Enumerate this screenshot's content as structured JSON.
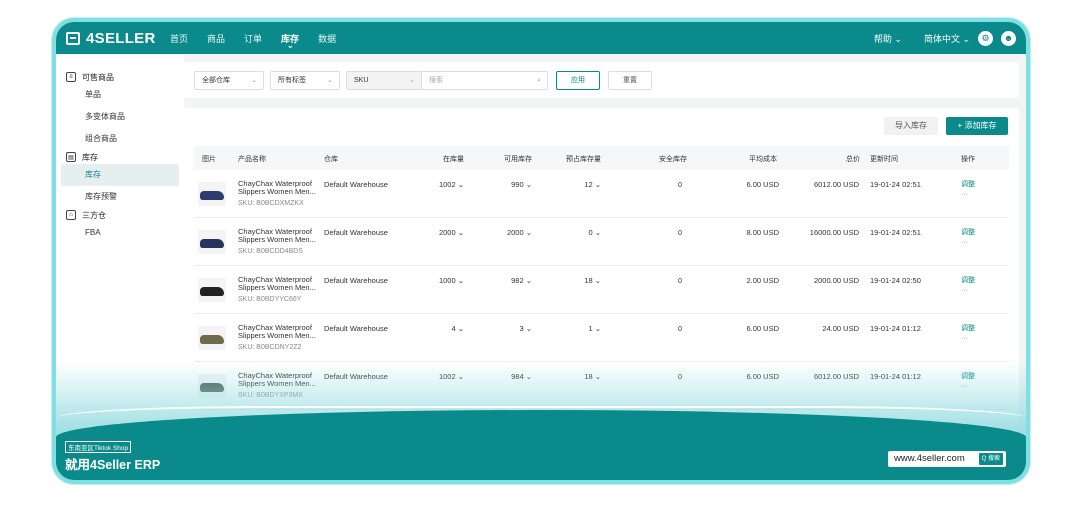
{
  "app": {
    "name": "4SELLER"
  },
  "nav": [
    "首页",
    "商品",
    "订单",
    "库存",
    "数据"
  ],
  "top_right": {
    "help": "帮助 ⌄",
    "lang": "简体中文 ⌄",
    "settings_icon": "⚙",
    "avatar_icon": "☻"
  },
  "sidebar": {
    "groups": [
      {
        "label": "可售商品",
        "items": [
          "单品",
          "多变体商品",
          "组合商品"
        ]
      },
      {
        "label": "库存",
        "items": [
          "库存",
          "库存预警"
        ]
      },
      {
        "label": "三方仓",
        "items": [
          "FBA"
        ]
      }
    ]
  },
  "filter": {
    "warehouse": "全部仓库",
    "tags": "所有标签",
    "field": "SKU",
    "search_placeholder": "搜索",
    "apply": "应用",
    "reset": "重置"
  },
  "actions": {
    "import": "导入库存",
    "add": "+ 添加库存"
  },
  "columns": [
    "图片",
    "产品名称",
    "仓库",
    "在库量",
    "可用库存",
    "预占库存量",
    "安全库存",
    "平均成本",
    "总价",
    "更新时间",
    "操作"
  ],
  "rows": [
    {
      "name": "ChayChax Waterproof Slippers Women Men...",
      "sku": "SKU: B0BCDXMZKX",
      "warehouse": "Default Warehouse",
      "onhand": "1002 ⌄",
      "available": "990 ⌄",
      "reserved": "12 ⌄",
      "safety": "0",
      "avg": "6.00 USD",
      "total": "6012.00 USD",
      "updated": "19-01-24 02:51",
      "op": "调整",
      "more": "···",
      "color": "#2c3c6e"
    },
    {
      "name": "ChayChax Waterproof Slippers Women Men...",
      "sku": "SKU: B0BCDD4BDS",
      "warehouse": "Default Warehouse",
      "onhand": "2000 ⌄",
      "available": "2000 ⌄",
      "reserved": "0 ⌄",
      "safety": "0",
      "avg": "8.00 USD",
      "total": "16000.00 USD",
      "updated": "19-01-24 02:51",
      "op": "调整",
      "more": "···",
      "color": "#27345f"
    },
    {
      "name": "ChayChax Waterproof Slippers Women Men...",
      "sku": "SKU: B0BDYYC66Y",
      "warehouse": "Default Warehouse",
      "onhand": "1000 ⌄",
      "available": "982 ⌄",
      "reserved": "18 ⌄",
      "safety": "0",
      "avg": "2.00 USD",
      "total": "2000.00 USD",
      "updated": "19-01-24 02:50",
      "op": "调整",
      "more": "···",
      "color": "#222222"
    },
    {
      "name": "ChayChax Waterproof Slippers Women Men...",
      "sku": "SKU: B0BCDNY2Z2",
      "warehouse": "Default Warehouse",
      "onhand": "4 ⌄",
      "available": "3 ⌄",
      "reserved": "1 ⌄",
      "safety": "0",
      "avg": "6.00 USD",
      "total": "24.00 USD",
      "updated": "19-01-24 01:12",
      "op": "调整",
      "more": "···",
      "color": "#6f6a4a"
    },
    {
      "name": "ChayChax Waterproof Slippers Women Men...",
      "sku": "SKU: B0BDYXP3MX",
      "warehouse": "Default Warehouse",
      "onhand": "1002 ⌄",
      "available": "984 ⌄",
      "reserved": "18 ⌄",
      "safety": "0",
      "avg": "6.00 USD",
      "total": "6012.00 USD",
      "updated": "19-01-24 01:12",
      "op": "调整",
      "more": "···",
      "color": "#4a5c58"
    }
  ],
  "banner": {
    "tag": "东南亚区Tiktok Shop",
    "title": "就用4Seller ERP",
    "url": "www.4seller.com",
    "search": "Q 搜索"
  }
}
